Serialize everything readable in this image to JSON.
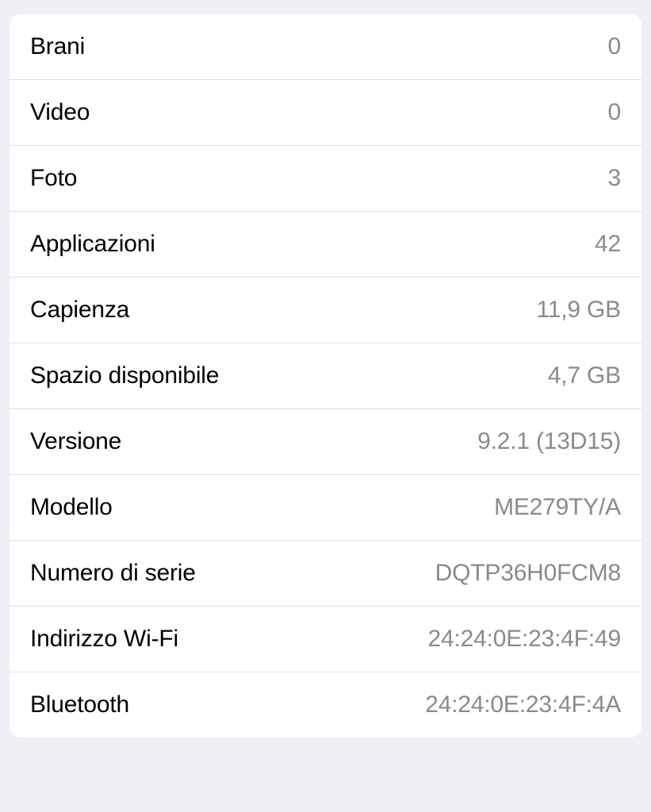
{
  "info": {
    "rows": [
      {
        "label": "Brani",
        "value": "0"
      },
      {
        "label": "Video",
        "value": "0"
      },
      {
        "label": "Foto",
        "value": "3"
      },
      {
        "label": "Applicazioni",
        "value": "42"
      },
      {
        "label": "Capienza",
        "value": "11,9 GB"
      },
      {
        "label": "Spazio disponibile",
        "value": "4,7 GB"
      },
      {
        "label": "Versione",
        "value": "9.2.1 (13D15)"
      },
      {
        "label": "Modello",
        "value": "ME279TY/A"
      },
      {
        "label": "Numero di serie",
        "value": "DQTP36H0FCM8"
      },
      {
        "label": "Indirizzo Wi-Fi",
        "value": "24:24:0E:23:4F:49"
      },
      {
        "label": "Bluetooth",
        "value": "24:24:0E:23:4F:4A"
      }
    ]
  }
}
